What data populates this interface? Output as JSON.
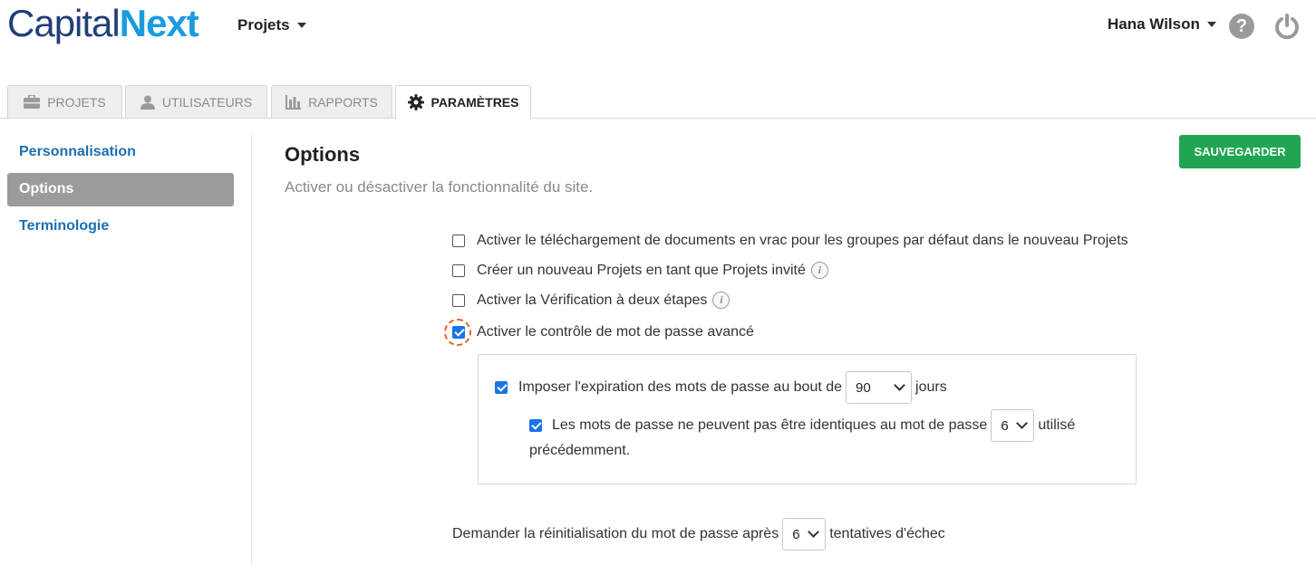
{
  "header": {
    "logo_part1": "Capital",
    "logo_part2": "Next",
    "projects_menu": "Projets",
    "user_name": "Hana Wilson",
    "help_glyph": "?"
  },
  "tabs": [
    {
      "label": "PROJETS",
      "icon": "briefcase-icon",
      "active": false
    },
    {
      "label": "UTILISATEURS",
      "icon": "user-icon",
      "active": false
    },
    {
      "label": "RAPPORTS",
      "icon": "bar-chart-icon",
      "active": false
    },
    {
      "label": "PARAMÈTRES",
      "icon": "gear-icon",
      "active": true
    }
  ],
  "sidebar": {
    "items": [
      {
        "label": "Personnalisation",
        "active": false
      },
      {
        "label": "Options",
        "active": true
      },
      {
        "label": "Terminologie",
        "active": false
      }
    ]
  },
  "main": {
    "title": "Options",
    "subtitle": "Activer ou désactiver la fonctionnalité du site.",
    "save_label": "SAUVEGARDER",
    "options": [
      {
        "label": "Activer le téléchargement de documents en vrac pour les groupes par défaut dans le nouveau Projets",
        "checked": false,
        "info": false
      },
      {
        "label": "Créer un nouveau Projets en tant que Projets invité",
        "checked": false,
        "info": true
      },
      {
        "label": "Activer la Vérification à deux étapes",
        "checked": false,
        "info": true
      },
      {
        "label": "Activer le contrôle de mot de passe avancé",
        "checked": true,
        "info": false
      }
    ],
    "expiration": {
      "label_before": "Imposer l'expiration des mots de passe au bout de",
      "value": "90",
      "label_after": "jours",
      "checked": true
    },
    "history": {
      "label_before": "Les mots de passe ne peuvent pas être identiques au mot de passe",
      "value": "6",
      "label_after": "utilisé",
      "label_line2": "précédemment.",
      "checked": true
    },
    "reset": {
      "label_before": "Demander la réinitialisation du mot de passe après",
      "value": "6",
      "label_after": "tentatives d'échec"
    },
    "info_glyph": "i"
  },
  "colors": {
    "accent": "#1a73e8",
    "save": "#20a653",
    "link": "#1b6fb3",
    "focus": "#e0662a"
  }
}
